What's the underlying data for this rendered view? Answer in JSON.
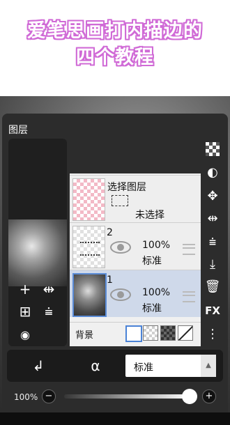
{
  "banner": {
    "line1": "爱笔思画打内描边的",
    "line2": "四个教程"
  },
  "panel": {
    "title": "图层"
  },
  "layers": [
    {
      "name": "选择图层",
      "status": "未选择",
      "thumbnail": "pink-checker"
    },
    {
      "number": "2",
      "opacity": "100%",
      "blend": "标准",
      "thumbnail": "sketch"
    },
    {
      "number": "1",
      "opacity": "100%",
      "blend": "标准",
      "thumbnail": "photo",
      "selected": true
    }
  ],
  "background_row": {
    "label": "背景"
  },
  "preview_tools": [
    "add-icon",
    "flip-horizontal-icon",
    "add-copy-icon",
    "merge-down-icon",
    "camera-icon"
  ],
  "right_tools": [
    "checker-icon",
    "half-circle-icon",
    "move-icon",
    "flip-horizontal-icon",
    "flip-vertical-icon",
    "download-icon",
    "trash-icon",
    "fx-icon",
    "more-vertical-icon"
  ],
  "right_tool_fx_label": "FX",
  "bottom": {
    "blend_mode": "标准",
    "clip_icon": "clip-arrow-icon",
    "lock_icon": "alpha-lock-icon"
  },
  "opacity": {
    "label": "100%",
    "minus": "−",
    "plus": "+",
    "value": 1.0
  },
  "colors": {
    "banner_outline": "#d06ad6",
    "selection": "#cfd9ea",
    "accent": "#5a8bd6"
  }
}
